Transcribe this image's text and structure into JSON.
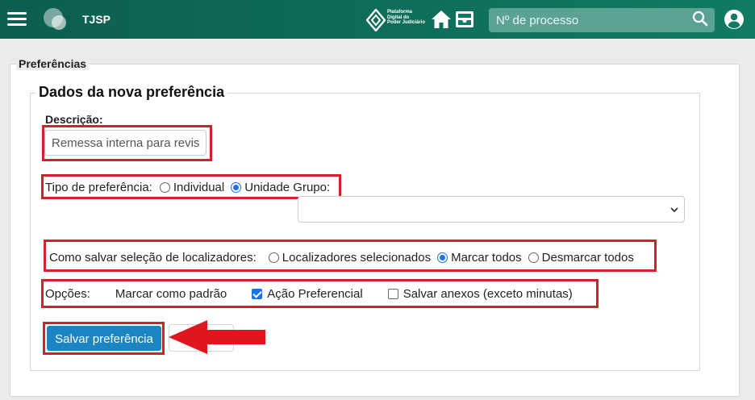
{
  "header": {
    "app_name": "TJSP",
    "platform_logo_text": [
      "Plataforma",
      "Digital do",
      "Poder Judiciário"
    ],
    "search": {
      "placeholder": "Nº de processo",
      "value": ""
    },
    "icons": [
      "menu-icon",
      "app-logo-icon",
      "home-icon",
      "inbox-icon",
      "search-icon",
      "user-account-icon"
    ]
  },
  "page": {
    "section_title": "Preferências",
    "form": {
      "title": "Dados da nova preferência",
      "description": {
        "label": "Descrição:",
        "value": "Remessa interna para revis"
      },
      "preference_type": {
        "label": "Tipo de preferência:",
        "options": [
          {
            "label": "Individual",
            "selected": false
          },
          {
            "label": "Unidade Grupo:",
            "selected": true
          }
        ],
        "group_select_value": ""
      },
      "locator_selection": {
        "label": "Como salvar seleção de localizadores:",
        "options": [
          {
            "label": "Localizadores selecionados",
            "selected": false
          },
          {
            "label": "Marcar todos",
            "selected": true
          },
          {
            "label": "Desmarcar todos",
            "selected": false
          }
        ]
      },
      "options": {
        "label": "Opções:",
        "default_text": "Marcar como padrão",
        "items": [
          {
            "label": "Ação Preferencial",
            "checked": true
          },
          {
            "label": "Salvar anexos (exceto minutas)",
            "checked": false
          }
        ]
      },
      "save_button": "Salvar preferência"
    }
  },
  "colors": {
    "header_bg": "#0f6e5b",
    "highlight": "#d4202a",
    "primary_button": "#1b84c2",
    "radio_accent": "#1a73e8"
  }
}
